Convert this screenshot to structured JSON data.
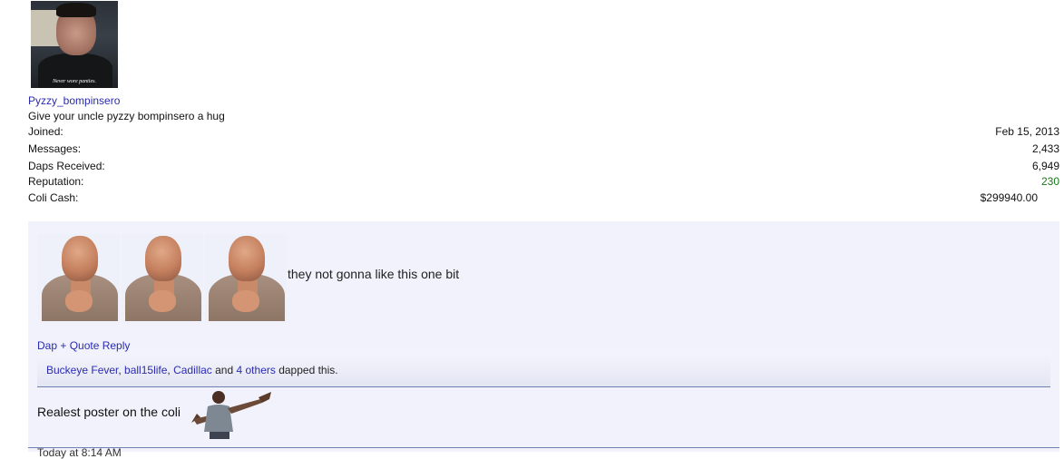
{
  "user": {
    "avatar_caption": "Never wore panties.",
    "username": "Pyzzy_bompinsero",
    "title": "Give your uncle pyzzy bompinsero a hug",
    "stats": [
      {
        "label": "Joined:",
        "value": "Feb 15, 2013"
      },
      {
        "label": "Messages:",
        "value": "2,433"
      },
      {
        "label": "Daps Received:",
        "value": "6,949"
      },
      {
        "label": "Reputation:",
        "value": "230"
      },
      {
        "label": "Coli Cash:",
        "value": "$299940.00"
      }
    ]
  },
  "post": {
    "text": "they not gonna like this one bit",
    "reply_link": "Dap + Quote Reply",
    "daps": {
      "users": [
        "Buckeye Fever",
        "ball15life",
        "Cadillac"
      ],
      "and_label": "and",
      "others_link": "4 others",
      "suffix": "dapped this."
    },
    "signature_text": "Realest poster on the coli",
    "cut_off_text": "Today at 8:14 AM"
  },
  "colors": {
    "link": "#2b2bb0",
    "reputation": "#1a7a1a",
    "post_background": "#f1f2fb",
    "rule": "#6f7fb0"
  }
}
